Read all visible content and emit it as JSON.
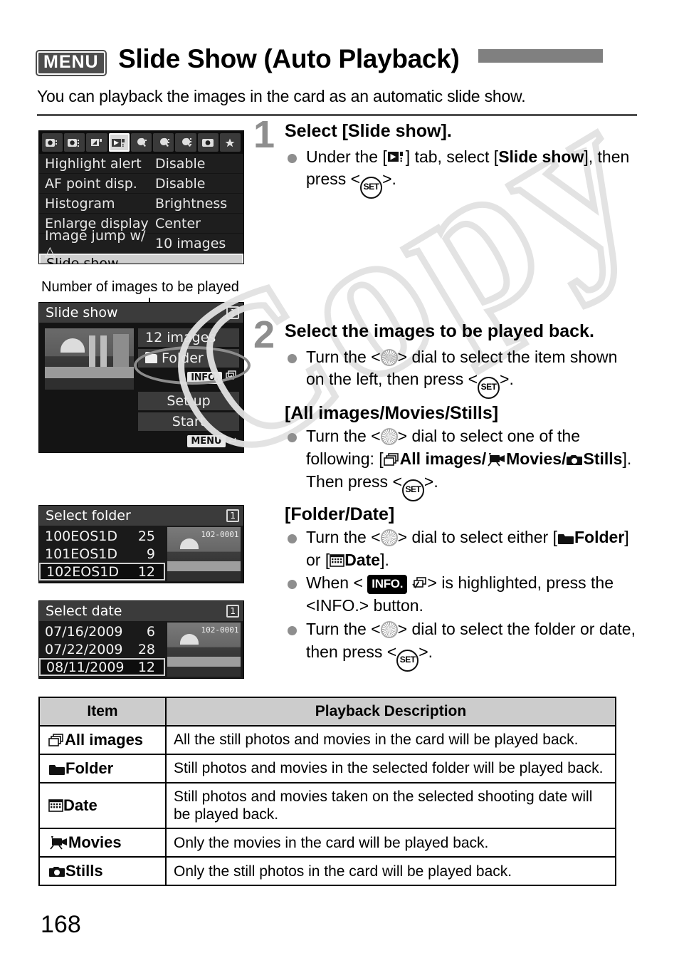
{
  "header": {
    "menu_badge": "MENU",
    "title": "Slide Show (Auto Playback)",
    "intro": "You can playback the images in the card as an automatic slide show.",
    "bar_color": "#808080"
  },
  "watermark": {
    "text": "Copy"
  },
  "menu_screen": {
    "tabs": [
      "shoot-1-icon",
      "shoot-2-icon",
      "shoot-3-icon",
      "playback-2-icon",
      "setup-1-icon",
      "setup-2-icon",
      "setup-3-icon",
      "custom-icon",
      "my-menu-icon"
    ],
    "active_tab_index": 3,
    "rows": [
      {
        "label": "Highlight alert",
        "value": "Disable"
      },
      {
        "label": "AF point disp.",
        "value": "Disable"
      },
      {
        "label": "Histogram",
        "value": "Brightness"
      },
      {
        "label": "Enlarge display",
        "value": "Center"
      },
      {
        "label": "Image jump w/",
        "value": "10 images"
      },
      {
        "label": "Slide show",
        "value": ""
      }
    ],
    "selected_row_index": 5
  },
  "caption_image_count": "Number of images to be played",
  "slideshow_screen": {
    "title": "Slide show",
    "card_badge": "1",
    "image_count": "12 images",
    "source": "Folder",
    "info_chip": "INFO.",
    "buttons": [
      "Set up",
      "Start"
    ],
    "menu_chip": "MENU"
  },
  "folder_screen": {
    "title": "Select folder",
    "card_badge": "1",
    "rows": [
      {
        "name": "100EOS1D",
        "count": "25"
      },
      {
        "name": "101EOS1D",
        "count": "9"
      },
      {
        "name": "102EOS1D",
        "count": "12"
      }
    ],
    "selected_index": 2,
    "preview_file": "102-0001"
  },
  "date_screen": {
    "title": "Select date",
    "card_badge": "1",
    "rows": [
      {
        "name": "07/16/2009",
        "count": "6"
      },
      {
        "name": "07/22/2009",
        "count": "28"
      },
      {
        "name": "08/11/2009",
        "count": "12"
      }
    ],
    "selected_index": 2,
    "preview_file": "102-0001"
  },
  "steps": [
    {
      "num": "1",
      "heading": "Select [Slide show].",
      "bullet_1_pre": "Under the [",
      "bullet_1_mid": "] tab, select [",
      "bullet_1_bold": "Slide show",
      "bullet_1_post": "], then press <",
      "bullet_1_end": ">."
    },
    {
      "num": "2",
      "heading": "Select the images to be played back.",
      "bullet_1_pre": "Turn the <",
      "bullet_1_mid": "> dial to select the item shown on the left, then press <",
      "bullet_1_end": ">."
    }
  ],
  "section_all": {
    "heading": "[All images/Movies/Stills]",
    "b1_pre": "Turn the <",
    "b1_mid": "> dial to select one of the following: [",
    "b1_all": "All images",
    "b1_slash1": "/",
    "b1_movies": "Movies",
    "b1_slash2": "/",
    "b1_stills": "Stills",
    "b1_post": "]. Then press <",
    "b1_end": ">."
  },
  "section_folder": {
    "heading": "[Folder/Date]",
    "b1_pre": "Turn the <",
    "b1_mid": "> dial to select either [",
    "b1_folder": "Folder",
    "b1_or": "] or [",
    "b1_date": "Date",
    "b1_end": "].",
    "b2_pre": "When <",
    "b2_badge": "INFO.",
    "b2_mid": "> is highlighted, press the <INFO.> button.",
    "b3_pre": "Turn the <",
    "b3_mid": "> dial to select the folder or date, then press <",
    "b3_end": ">."
  },
  "table": {
    "headers": [
      "Item",
      "Playback Description"
    ],
    "rows": [
      {
        "icon": "stack-icon",
        "item": "All images",
        "desc": "All the still photos and movies in the card will be played back."
      },
      {
        "icon": "folder-icon",
        "item": "Folder",
        "desc": "Still photos and movies in the selected folder will be played back."
      },
      {
        "icon": "calendar-icon",
        "item": "Date",
        "desc": "Still photos and movies taken on the selected shooting date will be played back."
      },
      {
        "icon": "movie-icon",
        "item": "Movies",
        "desc": "Only the movies in the card will be played back."
      },
      {
        "icon": "camera-icon",
        "item": "Stills",
        "desc": "Only the still photos in the card will be played back."
      }
    ]
  },
  "page_number": "168"
}
